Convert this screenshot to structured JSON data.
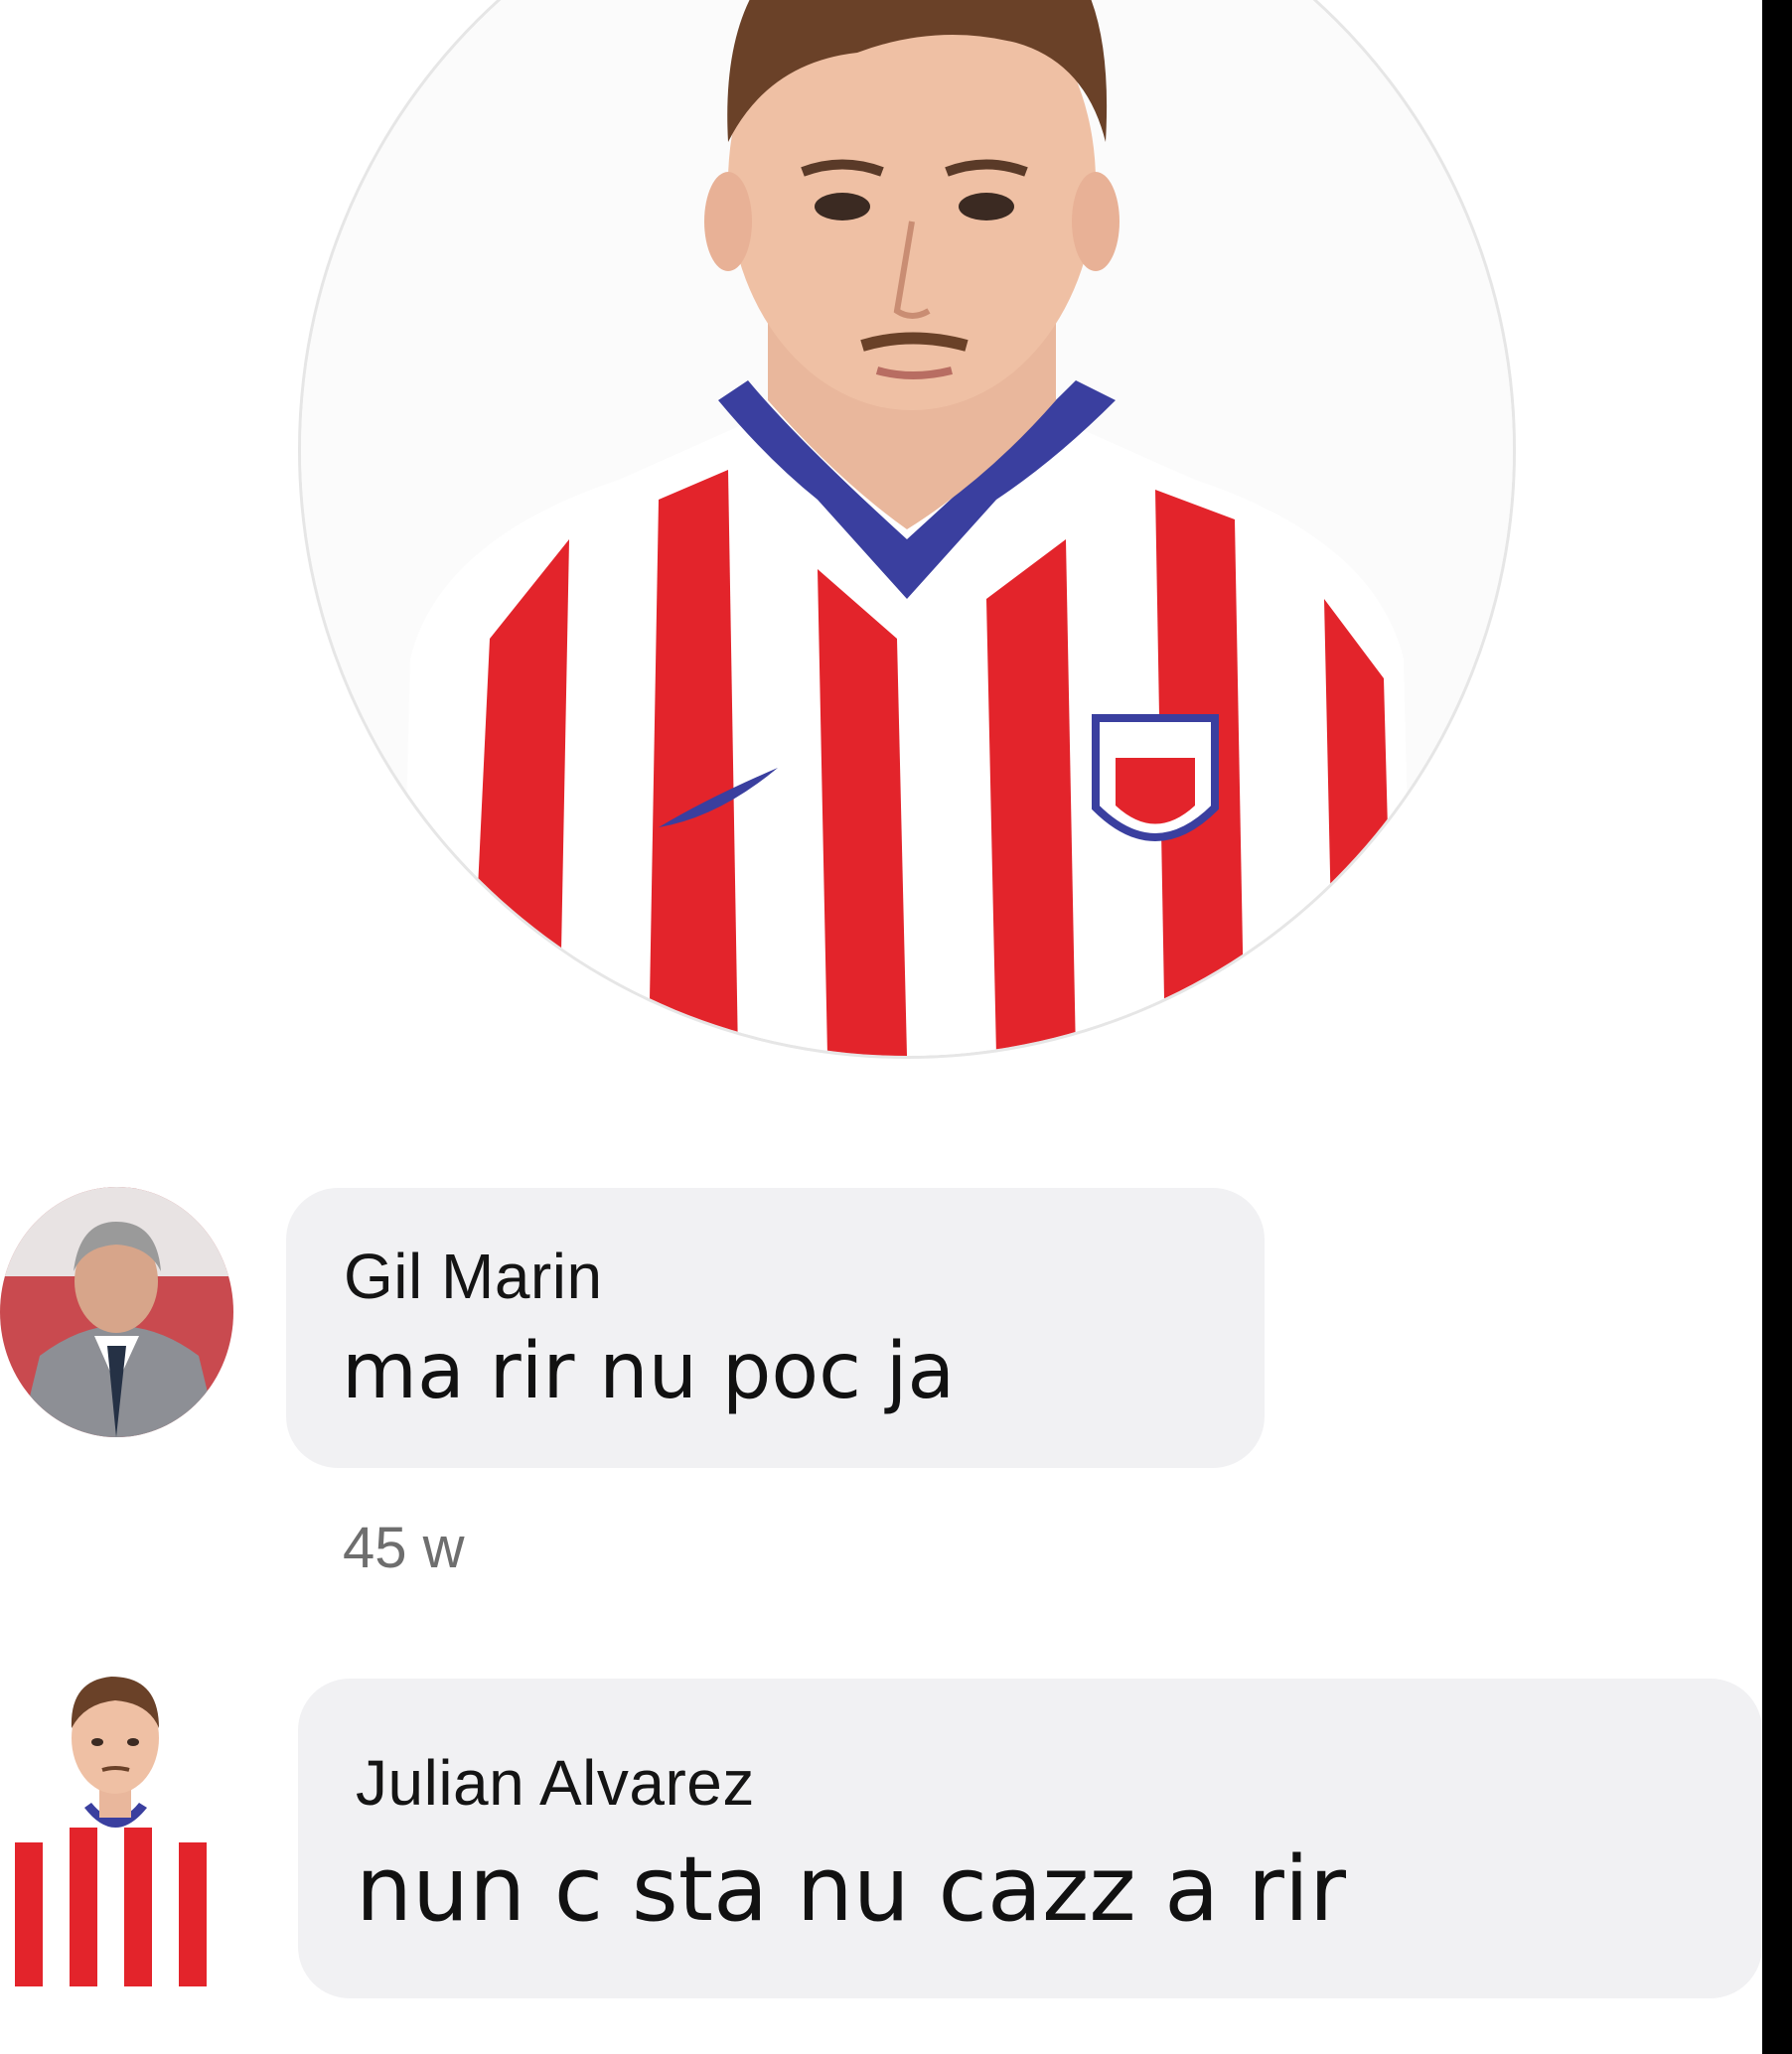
{
  "profile": {
    "photo_icon": "player-portrait-photo"
  },
  "comments": [
    {
      "author": "Gil Marin",
      "text": "ma rir nu poc ja",
      "timestamp": "45 w",
      "avatar_icon": "avatar-photo-gil-marin"
    },
    {
      "author": "Julian Alvarez",
      "text": "nun c sta nu cazz a rir",
      "avatar_icon": "avatar-photo-julian-alvarez"
    }
  ],
  "colors": {
    "bubble": "#f1f1f3",
    "text": "#111111",
    "timestamp": "#6e6e6e",
    "jersey_red": "#e3242b",
    "jersey_blue": "#3a3f9f"
  }
}
